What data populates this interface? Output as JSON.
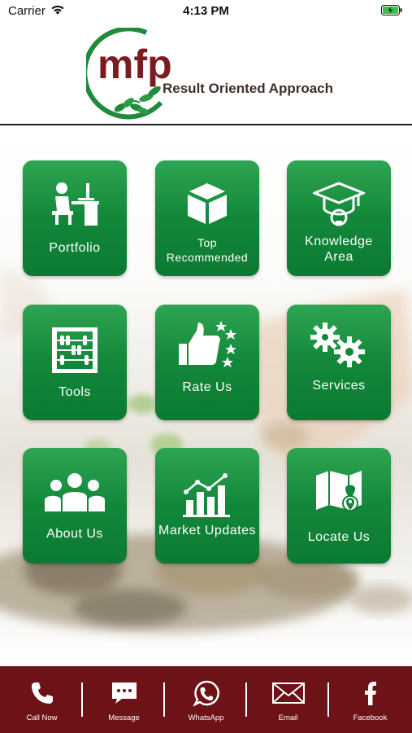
{
  "status_bar": {
    "carrier": "Carrier",
    "time": "4:13 PM"
  },
  "header": {
    "logo_text": "mfp",
    "tagline": "Result Oriented Approach"
  },
  "tiles": [
    {
      "label": "Portfolio",
      "icon": "desk-worker-icon"
    },
    {
      "label": "Top Recommended",
      "icon": "box-icon"
    },
    {
      "label": "Knowledge Area",
      "icon": "graduation-cap-icon"
    },
    {
      "label": "Tools",
      "icon": "abacus-icon"
    },
    {
      "label": "Rate Us",
      "icon": "thumbs-up-stars-icon"
    },
    {
      "label": "Services",
      "icon": "gears-icon"
    },
    {
      "label": "About Us",
      "icon": "group-icon"
    },
    {
      "label": "Market Updates",
      "icon": "growth-chart-icon"
    },
    {
      "label": "Locate Us",
      "icon": "map-pin-icon"
    }
  ],
  "bottom_bar": [
    {
      "label": "Call Now",
      "icon": "phone-icon"
    },
    {
      "label": "Message",
      "icon": "message-icon"
    },
    {
      "label": "WhatsApp",
      "icon": "whatsapp-icon"
    },
    {
      "label": "Email",
      "icon": "email-icon"
    },
    {
      "label": "Facebook",
      "icon": "facebook-icon"
    }
  ],
  "colors": {
    "tile_green": "#12873a",
    "bottom_bar": "#6d1216",
    "logo_green": "#1f8a3a",
    "logo_maroon": "#7a1b1f"
  }
}
